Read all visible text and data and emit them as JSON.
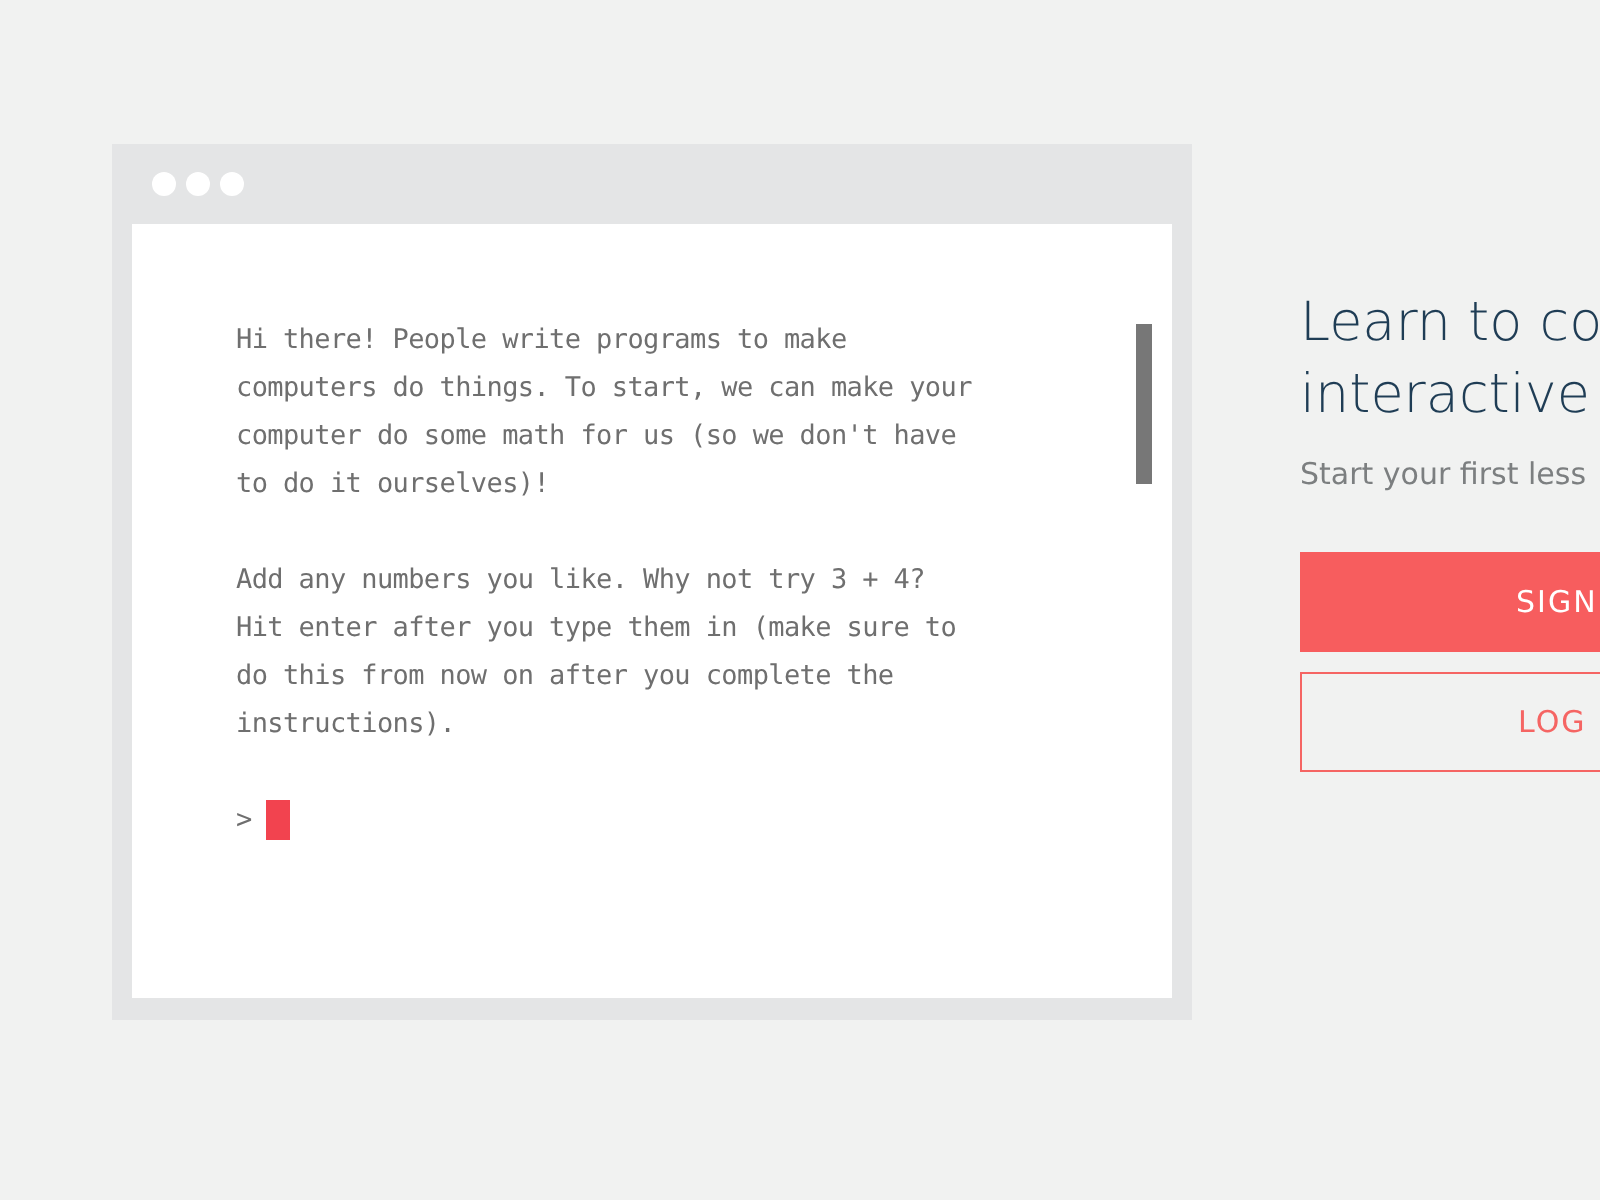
{
  "terminal": {
    "paragraphs": [
      "Hi there! People write programs to make computers do things. To start, we can make your computer do some math for us (so we don't have to do it ourselves)!",
      "Add any numbers you like. Why not try 3 + 4? Hit enter after you type them in (make sure to do this from now on after you complete the instructions)."
    ],
    "prompt": ">"
  },
  "hero": {
    "title_lines": [
      "Learn to co",
      "interactive"
    ],
    "subtitle": "Start your first less",
    "buttons": [
      {
        "label": "SIGN",
        "kind": "primary"
      },
      {
        "label": "LOG",
        "kind": "outline"
      }
    ]
  }
}
